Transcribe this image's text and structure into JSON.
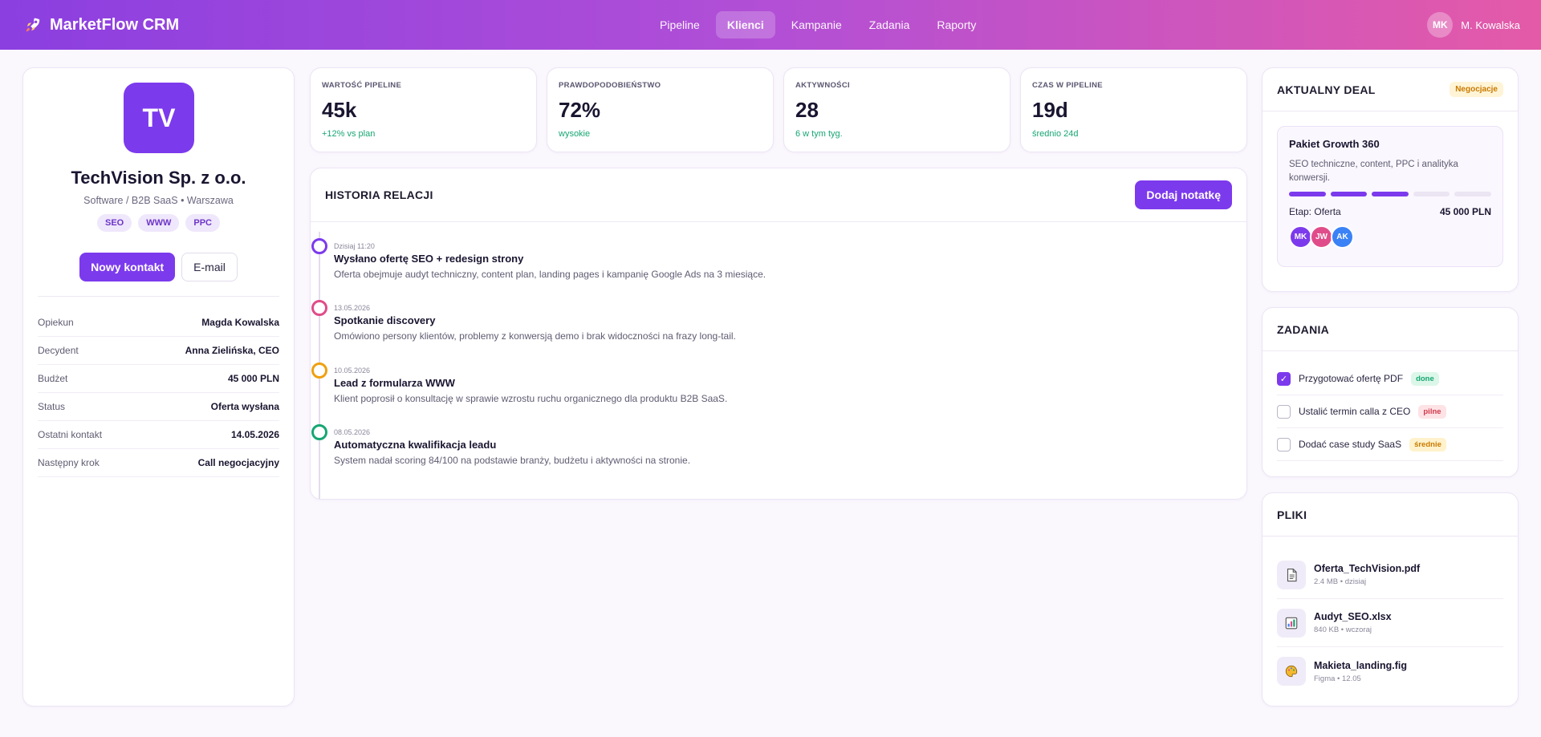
{
  "app": {
    "name": "MarketFlow CRM",
    "logo_icon": "rocket-icon"
  },
  "nav": [
    {
      "label": "Pipeline",
      "active": false
    },
    {
      "label": "Klienci",
      "active": true
    },
    {
      "label": "Kampanie",
      "active": false
    },
    {
      "label": "Zadania",
      "active": false
    },
    {
      "label": "Raporty",
      "active": false
    }
  ],
  "user": {
    "initials": "MK",
    "name": "M. Kowalska"
  },
  "client": {
    "initials": "TV",
    "name": "TechVision Sp. z o.o.",
    "subtitle": "Software / B2B SaaS • Warszawa",
    "tags": [
      "SEO",
      "WWW",
      "PPC"
    ],
    "new_contact_label": "Nowy kontakt",
    "email_label": "E-mail",
    "details": [
      {
        "key": "Opiekun",
        "value": "Magda Kowalska"
      },
      {
        "key": "Decydent",
        "value": "Anna Zielińska, CEO"
      },
      {
        "key": "Budżet",
        "value": "45 000 PLN"
      },
      {
        "key": "Status",
        "value": "Oferta wysłana"
      },
      {
        "key": "Ostatni kontakt",
        "value": "14.05.2026"
      },
      {
        "key": "Następny krok",
        "value": "Call negocjacyjny"
      }
    ]
  },
  "kpis": [
    {
      "label": "WARTOŚĆ PIPELINE",
      "value": "45k",
      "note": "+12% vs plan"
    },
    {
      "label": "PRAWDOPODOBIEŃSTWO",
      "value": "72%",
      "note": "wysokie"
    },
    {
      "label": "AKTYWNOŚCI",
      "value": "28",
      "note": "6 w tym tyg."
    },
    {
      "label": "CZAS W PIPELINE",
      "value": "19d",
      "note": "średnio 24d"
    }
  ],
  "history": {
    "title": "HISTORIA RELACJI",
    "add_note_label": "Dodaj notatkę",
    "items": [
      {
        "date": "Dzisiaj 11:20",
        "title": "Wysłano ofertę SEO + redesign strony",
        "desc": "Oferta obejmuje audyt techniczny, content plan, landing pages i kampanię Google Ads na 3 miesiące.",
        "color": "#7c3aed"
      },
      {
        "date": "13.05.2026",
        "title": "Spotkanie discovery",
        "desc": "Omówiono persony klientów, problemy z konwersją demo i brak widoczności na frazy long-tail.",
        "color": "#e04c8a"
      },
      {
        "date": "10.05.2026",
        "title": "Lead z formularza WWW",
        "desc": "Klient poprosił o konsultację w sprawie wzrostu ruchu organicznego dla produktu B2B SaaS.",
        "color": "#f0a010"
      },
      {
        "date": "08.05.2026",
        "title": "Automatyczna kwalifikacja leadu",
        "desc": "System nadał scoring 84/100 na podstawie branży, budżetu i aktywności na stronie.",
        "color": "#17a673"
      }
    ]
  },
  "deal": {
    "title": "AKTUALNY DEAL",
    "badge": "Negocjacje",
    "name": "Pakiet Growth 360",
    "desc": "SEO techniczne, content, PPC i analityka konwersji.",
    "progress_steps_done": 3,
    "progress_steps_total": 5,
    "stage": "Etap: Oferta",
    "amount": "45 000 PLN",
    "team": [
      {
        "initials": "MK",
        "color": "#7c3aed"
      },
      {
        "initials": "JW",
        "color": "#e04c8a"
      },
      {
        "initials": "AK",
        "color": "#3b82f6"
      }
    ]
  },
  "tasks": {
    "title": "ZADANIA",
    "items": [
      {
        "label": "Przygotować ofertę PDF",
        "done": true,
        "badge": "done",
        "badge_type": "done"
      },
      {
        "label": "Ustalić termin calla z CEO",
        "done": false,
        "badge": "pilne",
        "badge_type": "urgent"
      },
      {
        "label": "Dodać case study SaaS",
        "done": false,
        "badge": "średnie",
        "badge_type": "mid"
      }
    ]
  },
  "files": {
    "title": "PLIKI",
    "items": [
      {
        "name": "Oferta_TechVision.pdf",
        "meta": "2.4 MB • dzisiaj",
        "icon": "document-icon"
      },
      {
        "name": "Audyt_SEO.xlsx",
        "meta": "840 KB • wczoraj",
        "icon": "spreadsheet-icon"
      },
      {
        "name": "Makieta_landing.fig",
        "meta": "Figma • 12.05",
        "icon": "palette-icon"
      }
    ]
  }
}
